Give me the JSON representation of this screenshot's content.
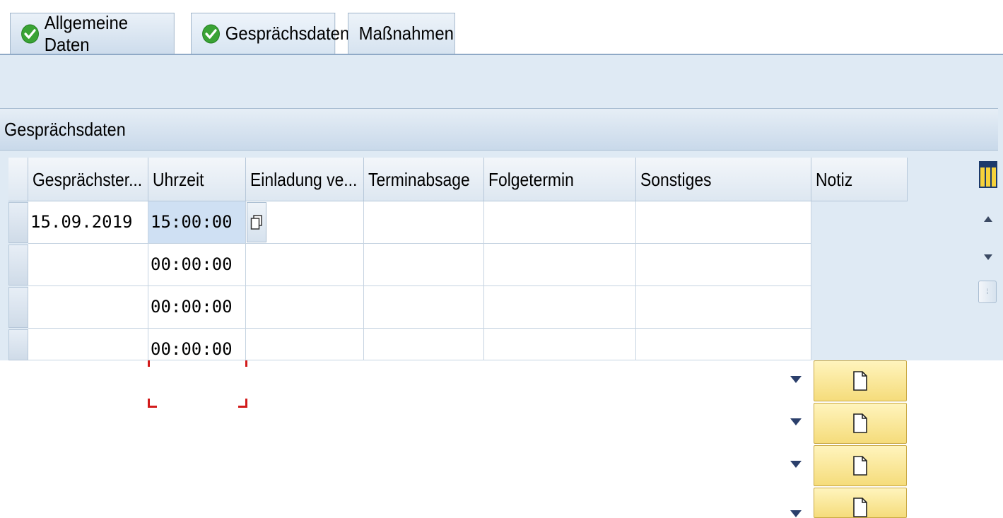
{
  "tabs": [
    {
      "label": "Allgemeine Daten",
      "status": "complete"
    },
    {
      "label": "Gesprächsdaten",
      "status": "complete",
      "active": true
    },
    {
      "label": "Maßnahmen"
    }
  ],
  "panel": {
    "title": "Gesprächsdaten"
  },
  "table": {
    "columns": [
      "Gesprächster...",
      "Uhrzeit",
      "Einladung ve...",
      "Terminabsage",
      "Folgetermin",
      "Sonstiges",
      "Notiz"
    ],
    "rows": [
      {
        "date": "15.09.2019",
        "time": "15:00:00"
      },
      {
        "date": "",
        "time": "00:00:00"
      },
      {
        "date": "",
        "time": "00:00:00"
      },
      {
        "date": "",
        "time": "00:00:00"
      }
    ]
  },
  "icons": {
    "tab_status": "check-circle-icon",
    "value_help": "copy-icon",
    "dropdown": "dropdown-arrow-icon",
    "note": "document-icon",
    "column_config": "column-settings-icon",
    "scroll_up": "scroll-up-icon",
    "scroll_down": "scroll-down-icon"
  },
  "colors": {
    "check_green": "#3aa335",
    "note_yellow": "#f8e392",
    "focus_red": "#d21b1b",
    "background": "#dfeaf4"
  }
}
